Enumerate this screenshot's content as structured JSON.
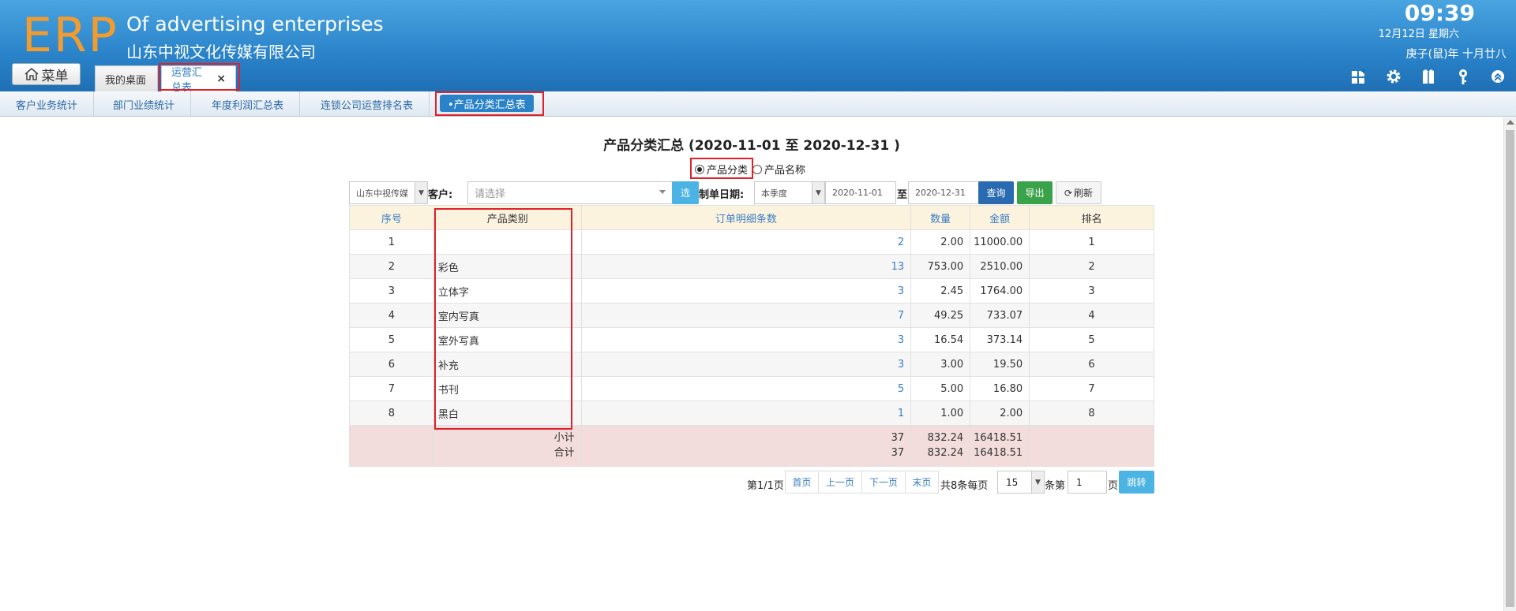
{
  "header": {
    "logo": "ERP",
    "company_en": "Of advertising enterprises",
    "company_cn": "山东中视文化传媒有限公司",
    "time": "09:39",
    "date": "12月12日 星期六",
    "lunar": "庚子(鼠)年 十月廿八",
    "menu_label": "菜单",
    "tabs": [
      {
        "label": "我的桌面"
      },
      {
        "label": "运营汇总表",
        "close": "×"
      }
    ],
    "tool_icons": [
      "dashboard-add-icon",
      "gear-icon",
      "shirt-icon",
      "key-icon",
      "collapse-up-icon"
    ]
  },
  "subnav": {
    "items": [
      "客户业务统计",
      "部门业绩统计",
      "年度利润汇总表",
      "连锁公司运营排名表"
    ],
    "active": "•产品分类汇总表"
  },
  "report": {
    "title": "产品分类汇总 (2020-11-01 至 2020-12-31 )",
    "radio_category": "产品分类",
    "radio_name": "产品名称"
  },
  "filters": {
    "company": "山东中视传媒",
    "customer_label": "客户:",
    "customer_placeholder": "请选择",
    "select_btn": "选",
    "date_label": "制单日期:",
    "period": "本季度",
    "date_from": "2020-11-01",
    "to_label": "至",
    "date_to": "2020-12-31",
    "query_btn": "查询",
    "export_btn": "导出",
    "refresh_btn": "刷新"
  },
  "table": {
    "headers": [
      "序号",
      "产品类别",
      "订单明细条数",
      "数量",
      "金额",
      "排名"
    ],
    "rows": [
      {
        "no": "1",
        "category": "",
        "count": "2",
        "qty": "2.00",
        "amount": "11000.00",
        "rank": "1"
      },
      {
        "no": "2",
        "category": "彩色",
        "count": "13",
        "qty": "753.00",
        "amount": "2510.00",
        "rank": "2"
      },
      {
        "no": "3",
        "category": "立体字",
        "count": "3",
        "qty": "2.45",
        "amount": "1764.00",
        "rank": "3"
      },
      {
        "no": "4",
        "category": "室内写真",
        "count": "7",
        "qty": "49.25",
        "amount": "733.07",
        "rank": "4"
      },
      {
        "no": "5",
        "category": "室外写真",
        "count": "3",
        "qty": "16.54",
        "amount": "373.14",
        "rank": "5"
      },
      {
        "no": "6",
        "category": "补充",
        "count": "3",
        "qty": "3.00",
        "amount": "19.50",
        "rank": "6"
      },
      {
        "no": "7",
        "category": "书刊",
        "count": "5",
        "qty": "5.00",
        "amount": "16.80",
        "rank": "7"
      },
      {
        "no": "8",
        "category": "黑白",
        "count": "1",
        "qty": "1.00",
        "amount": "2.00",
        "rank": "8"
      }
    ],
    "subtotal_label": "小计",
    "total_label": "合计",
    "subtotal": {
      "count": "37",
      "qty": "832.24",
      "amount": "16418.51"
    },
    "total": {
      "count": "37",
      "qty": "832.24",
      "amount": "16418.51"
    }
  },
  "pager": {
    "page_info": "第1/1页",
    "first": "首页",
    "prev": "上一页",
    "next": "下一页",
    "last": "末页",
    "per_page_text": "共8条每页",
    "per_page": "15",
    "goto_text": "条第",
    "page_input": "1",
    "page_suffix": "页",
    "jump": "跳转"
  }
}
